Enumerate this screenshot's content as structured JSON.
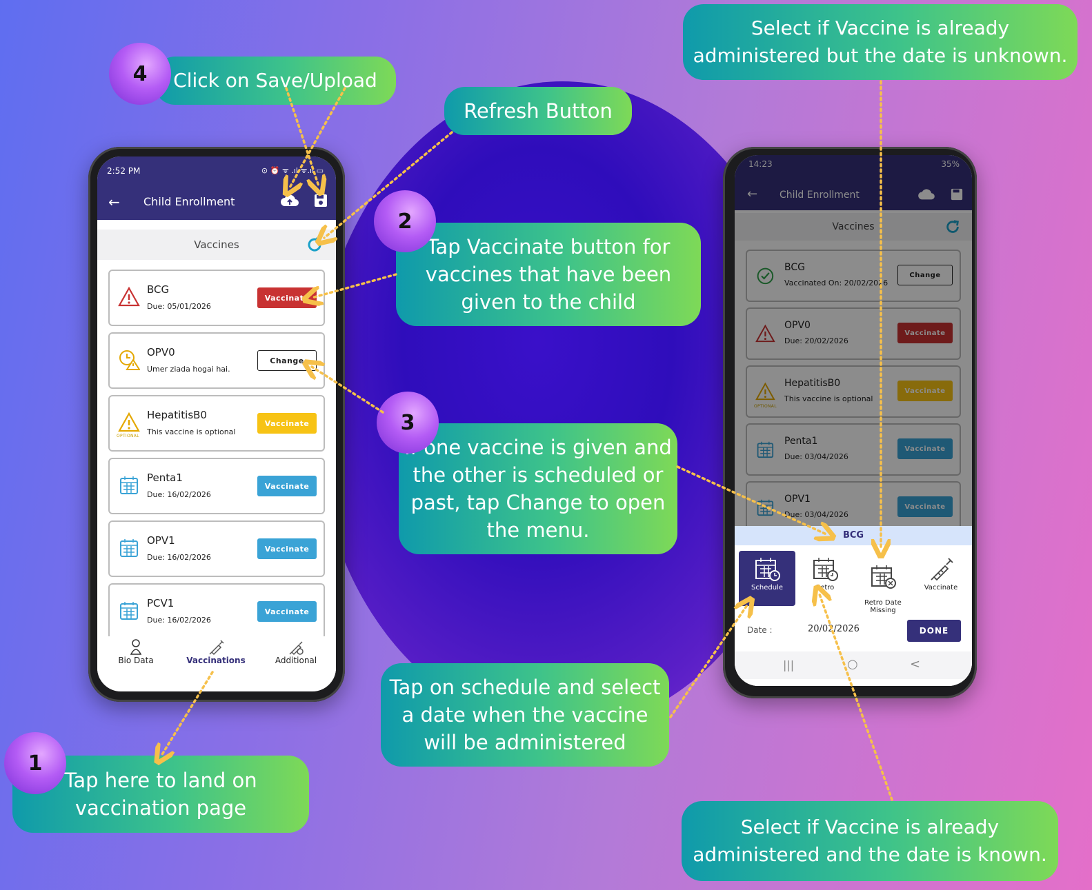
{
  "callouts": {
    "save_upload": "Click on Save/Upload",
    "refresh": "Refresh Button",
    "vaccinate": "Tap Vaccinate button for vaccines that have been given to the child",
    "change": "If one vaccine is given and the other is scheduled or past, tap Change to open the menu.",
    "schedule": "Tap on schedule and select a date when the vaccine will be administered",
    "landing": "Tap here to land on vaccination page",
    "retro_missing": "Select if Vaccine is already administered but the date is unknown.",
    "retro": "Select if Vaccine is already administered and the date is known."
  },
  "badges": {
    "b1": "1",
    "b2": "2",
    "b3": "3",
    "b4": "4"
  },
  "left_phone": {
    "time": "2:52 PM",
    "status_icons": "⊙ ⏰ ᯤ .ıl ᯤ.ıl ▭",
    "title": "Child Enrollment",
    "section_title": "Vaccines",
    "cards": [
      {
        "name": "BCG",
        "sub": "Due: 05/01/2026",
        "button": "Vaccinate",
        "style": "red",
        "icon": "warning-icon"
      },
      {
        "name": "OPV0",
        "sub": "Umer ziada hogai hai.",
        "button": "Change",
        "style": "change",
        "icon": "clock-warning-icon"
      },
      {
        "name": "HepatitisB0",
        "sub": "This vaccine is optional",
        "button": "Vaccinate",
        "style": "yellow",
        "icon": "warning-icon",
        "tag": "OPTIONAL"
      },
      {
        "name": "Penta1",
        "sub": "Due: 16/02/2026",
        "button": "Vaccinate",
        "style": "blue",
        "icon": "calendar-icon"
      },
      {
        "name": "OPV1",
        "sub": "Due: 16/02/2026",
        "button": "Vaccinate",
        "style": "blue",
        "icon": "calendar-icon"
      },
      {
        "name": "PCV1",
        "sub": "Due: 16/02/2026",
        "button": "Vaccinate",
        "style": "blue",
        "icon": "calendar-icon"
      }
    ],
    "nav": [
      "Bio Data",
      "Vaccinations",
      "Additional"
    ]
  },
  "right_phone": {
    "time": "14:23",
    "status_icons": "35%",
    "title": "Child Enrollment",
    "section_title": "Vaccines",
    "cards": [
      {
        "name": "BCG",
        "sub": "Vaccinated On: 20/02/2026",
        "button": "Change",
        "style": "change",
        "icon": "check-circle-icon"
      },
      {
        "name": "OPV0",
        "sub": "Due: 20/02/2026",
        "button": "Vaccinate",
        "style": "red",
        "icon": "warning-icon"
      },
      {
        "name": "HepatitisB0",
        "sub": "This vaccine is optional",
        "button": "Vaccinate",
        "style": "yellow",
        "icon": "warning-icon",
        "tag": "OPTIONAL"
      },
      {
        "name": "Penta1",
        "sub": "Due: 03/04/2026",
        "button": "Vaccinate",
        "style": "blue",
        "icon": "calendar-icon"
      },
      {
        "name": "OPV1",
        "sub": "Due: 03/04/2026",
        "button": "Vaccinate",
        "style": "blue",
        "icon": "calendar-icon"
      }
    ],
    "sheet": {
      "title": "BCG",
      "options": [
        "Schedule",
        "Retro",
        "Retro Date\nMissing",
        "Vaccinate"
      ],
      "date_label": "Date :",
      "date_value": "20/02/2026",
      "done": "DONE"
    },
    "sysnav": [
      "|||",
      "○",
      "<"
    ]
  },
  "colors": {
    "appbar": "#35307a",
    "accent_teal": "#1aa0c8",
    "red": "#c83232",
    "yellow": "#f7c315",
    "blue": "#3aa3d6",
    "arrow": "#f6c04a"
  }
}
